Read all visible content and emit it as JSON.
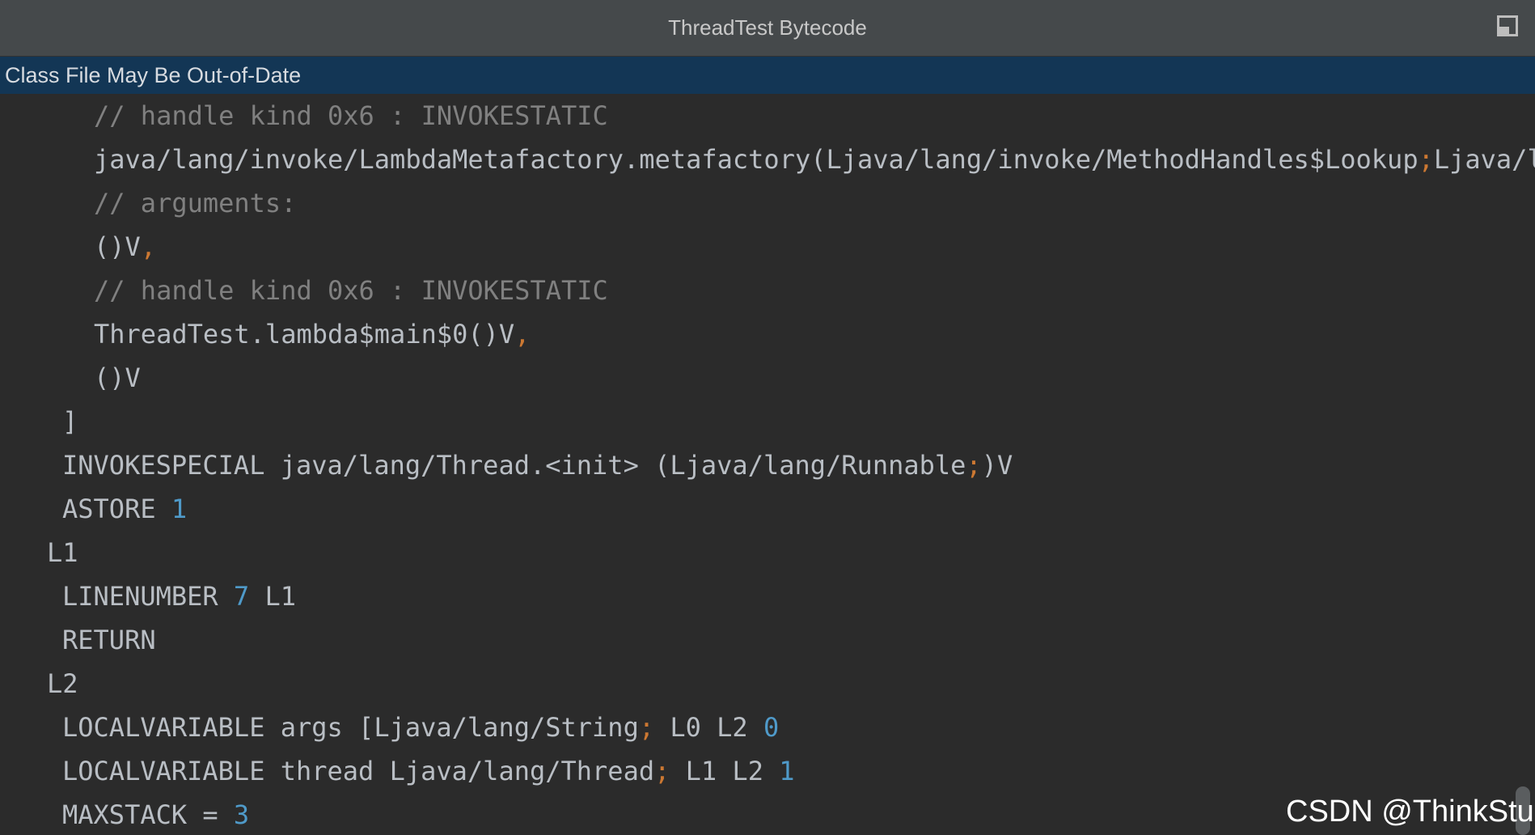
{
  "window": {
    "title": "ThreadTest Bytecode",
    "restore_icon": "window-restore-icon"
  },
  "banner": {
    "text": "Class File May Be Out-of-Date"
  },
  "code_lines": [
    [
      {
        "t": "// handle kind 0x6 : INVOKESTATIC",
        "c": "comment"
      }
    ],
    [
      {
        "t": "java/lang/invoke/LambdaMetafactory.metafactory(Ljava/lang/invoke/MethodHandles$Lookup",
        "c": "plain"
      },
      {
        "t": ";",
        "c": "punct"
      },
      {
        "t": "Ljava/l",
        "c": "plain"
      }
    ],
    [
      {
        "t": "// arguments:",
        "c": "comment"
      }
    ],
    [
      {
        "t": "()V",
        "c": "plain"
      },
      {
        "t": ",",
        "c": "punct"
      }
    ],
    [
      {
        "t": "// handle kind 0x6 : INVOKESTATIC",
        "c": "comment"
      }
    ],
    [
      {
        "t": "ThreadTest.lambda$main$0()V",
        "c": "plain"
      },
      {
        "t": ",",
        "c": "punct"
      }
    ],
    [
      {
        "t": "()V",
        "c": "plain"
      }
    ],
    [
      {
        "t": "]",
        "c": "plain"
      }
    ],
    [
      {
        "t": "INVOKESPECIAL java/lang/Thread.<init> (Ljava/lang/Runnable",
        "c": "plain"
      },
      {
        "t": ";",
        "c": "punct"
      },
      {
        "t": ")V",
        "c": "plain"
      }
    ],
    [
      {
        "t": "ASTORE ",
        "c": "plain"
      },
      {
        "t": "1",
        "c": "num"
      }
    ],
    [
      {
        "t": "L1",
        "c": "plain"
      }
    ],
    [
      {
        "t": "LINENUMBER ",
        "c": "plain"
      },
      {
        "t": "7",
        "c": "num"
      },
      {
        "t": " L1",
        "c": "plain"
      }
    ],
    [
      {
        "t": "RETURN",
        "c": "plain"
      }
    ],
    [
      {
        "t": "L2",
        "c": "plain"
      }
    ],
    [
      {
        "t": "LOCALVARIABLE args [Ljava/lang/String",
        "c": "plain"
      },
      {
        "t": ";",
        "c": "punct"
      },
      {
        "t": " L0 L2 ",
        "c": "plain"
      },
      {
        "t": "0",
        "c": "num"
      }
    ],
    [
      {
        "t": "LOCALVARIABLE thread Ljava/lang/Thread",
        "c": "plain"
      },
      {
        "t": ";",
        "c": "punct"
      },
      {
        "t": " L1 L2 ",
        "c": "plain"
      },
      {
        "t": "1",
        "c": "num"
      }
    ],
    [
      {
        "t": "MAXSTACK = ",
        "c": "plain"
      },
      {
        "t": "3",
        "c": "num"
      }
    ]
  ],
  "watermark": {
    "text": "CSDN @ThinkStu"
  }
}
